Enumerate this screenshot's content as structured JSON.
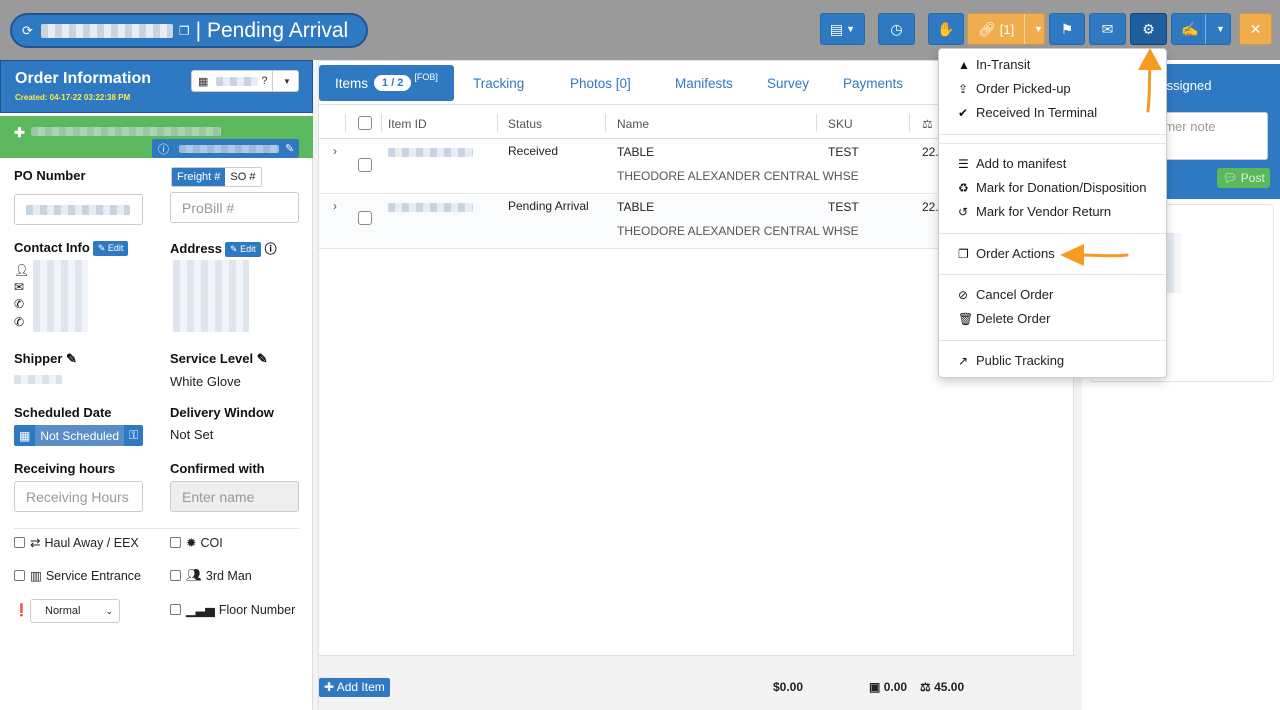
{
  "header": {
    "title": "| Pending Arrival",
    "link_label": "[1]"
  },
  "order_info": {
    "title": "Order Information",
    "created": "Created: 04-17-22 03:22:38 PM",
    "po_number_label": "PO Number",
    "freight_label": "Freight #",
    "so_label": "SO #",
    "probill_placeholder": "ProBill #",
    "contact_label": "Contact Info",
    "address_label": "Address",
    "edit_label": "Edit",
    "shipper_label": "Shipper",
    "service_level_label": "Service Level",
    "service_level_value": "White Glove",
    "scheduled_date_label": "Scheduled Date",
    "not_scheduled": "Not Scheduled",
    "delivery_window_label": "Delivery Window",
    "delivery_window_value": "Not Set",
    "receiving_hours_label": "Receiving hours",
    "receiving_hours_placeholder": "Receiving Hours",
    "confirmed_with_label": "Confirmed with",
    "confirmed_placeholder": "Enter name",
    "checkboxes": [
      "Haul Away / EEX",
      "COI",
      "Service Entrance",
      "3rd Man",
      "Floor Number"
    ],
    "priority_value": "Normal"
  },
  "tabs": {
    "items": "Items",
    "items_count": "1 / 2",
    "fob": "[FOB]",
    "tracking": "Tracking",
    "photos": "Photos [0]",
    "manifests": "Manifests",
    "survey": "Survey",
    "payments": "Payments"
  },
  "table": {
    "headers": [
      "Item ID",
      "Status",
      "Name",
      "SKU"
    ],
    "rows": [
      {
        "status": "Received",
        "name": "TABLE",
        "sku": "TEST",
        "weight": "22.",
        "location": "THEODORE ALEXANDER CENTRAL WHSE"
      },
      {
        "status": "Pending Arrival",
        "name": "TABLE",
        "sku": "TEST",
        "weight": "22.",
        "location": "THEODORE ALEXANDER CENTRAL WHSE"
      }
    ]
  },
  "footer": {
    "add_item": "Add Item",
    "total_cost": "$0.00",
    "total_volume": "0.00",
    "total_weight": "45.00"
  },
  "right_panel": {
    "assigned": "Assigned",
    "note_placeholder": "omer note",
    "post": "Post"
  },
  "menu": {
    "items": [
      "In-Transit",
      "Order Picked-up",
      "Received In Terminal",
      "Add to manifest",
      "Mark for Donation/Disposition",
      "Mark for Vendor Return",
      "Order Actions",
      "Cancel Order",
      "Delete Order",
      "Public Tracking"
    ]
  },
  "colors": {
    "primary": "#2f79c3",
    "success": "#5cb85c",
    "warning": "#f0ad4e",
    "arrow": "#f59a23",
    "created_text": "#ffe94a"
  }
}
